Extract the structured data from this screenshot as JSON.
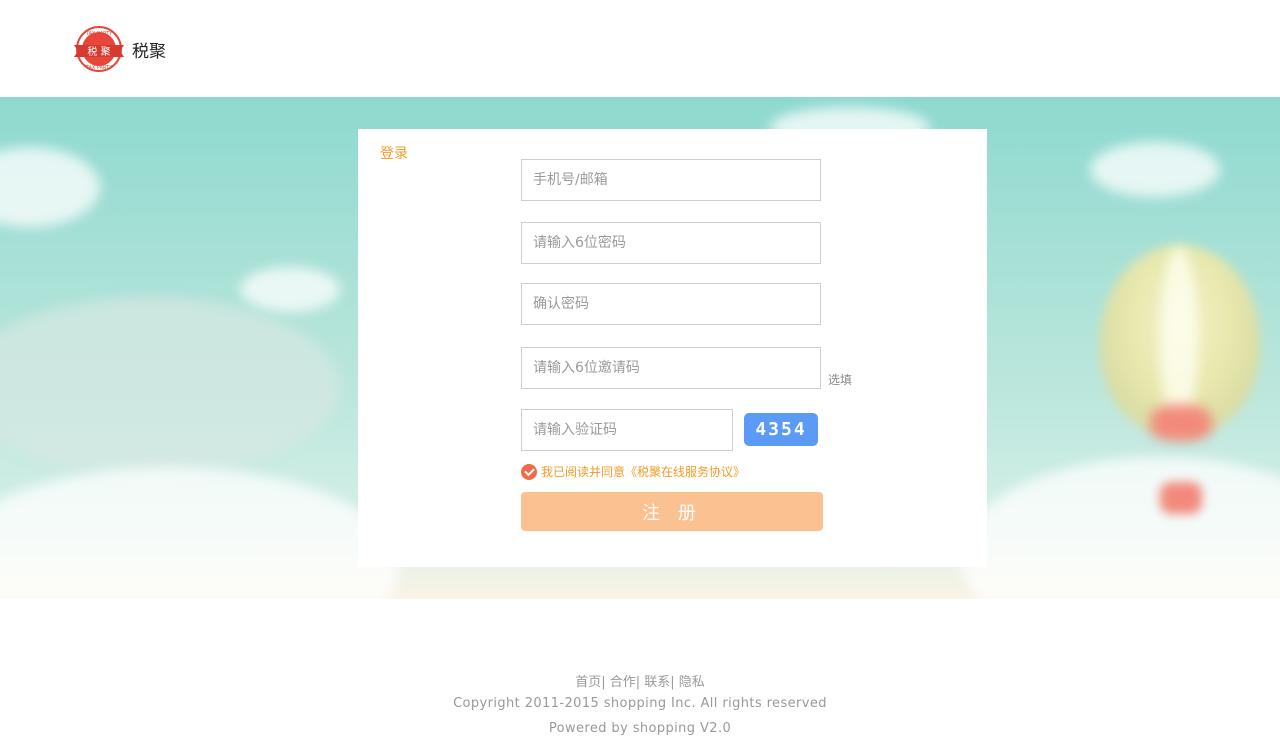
{
  "header": {
    "logo_text": "税聚",
    "logo_seal_text": "税 聚",
    "logo_seal_ring_text": "TAX PARTY"
  },
  "form": {
    "title": "登录",
    "fields": {
      "account_placeholder": "手机号/邮箱",
      "password_placeholder": "请输入6位密码",
      "confirm_placeholder": "确认密码",
      "invite_placeholder": "请输入6位邀请码",
      "verify_placeholder": "请输入验证码"
    },
    "optional_label": "选填",
    "captcha_code": "4354",
    "agreement_text": "我已阅读并同意《税聚在线服务协议》",
    "agreement_checked": true,
    "register_label": "注 册"
  },
  "footer": {
    "links": [
      {
        "label": "首页"
      },
      {
        "label": "合作"
      },
      {
        "label": "联系"
      },
      {
        "label": "隐私"
      }
    ],
    "copyright": "Copyright 2011-2015 shopping Inc. All rights reserved",
    "powered": "Powered by shopping V2.0"
  },
  "colors": {
    "accent": "#f39c28",
    "button": "#fcc190",
    "captcha": "#5c9bf5",
    "check": "#f06a4a"
  }
}
